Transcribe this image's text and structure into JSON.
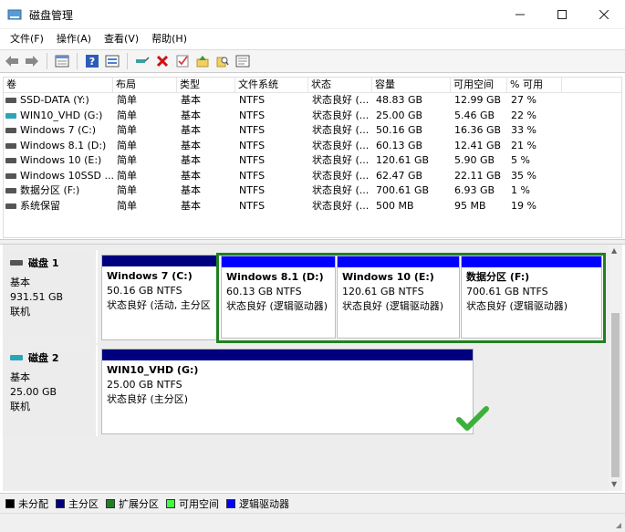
{
  "window": {
    "title": "磁盘管理",
    "controls": [
      "minimize-icon",
      "maximize-icon",
      "close-icon"
    ]
  },
  "menu": [
    "文件(F)",
    "操作(A)",
    "查看(V)",
    "帮助(H)"
  ],
  "toolbar": [
    "back-arrow-icon",
    "forward-arrow-icon",
    "properties-icon",
    "help-icon",
    "refresh-icon",
    "connect-icon",
    "delete-icon",
    "check-icon",
    "up-icon",
    "search-icon",
    "list-icon"
  ],
  "volumes": {
    "headers": [
      "卷",
      "布局",
      "类型",
      "文件系统",
      "状态",
      "容量",
      "可用空间",
      "% 可用"
    ],
    "rows": [
      {
        "icon": "drive-icon",
        "cells": [
          "SSD-DATA (Y:)",
          "简单",
          "基本",
          "NTFS",
          "状态良好 (...",
          "48.83 GB",
          "12.99 GB",
          "27 %"
        ]
      },
      {
        "icon": "vhd-drive-icon",
        "cells": [
          "WIN10_VHD (G:)",
          "简单",
          "基本",
          "NTFS",
          "状态良好 (...",
          "25.00 GB",
          "5.46 GB",
          "22 %"
        ]
      },
      {
        "icon": "drive-icon",
        "cells": [
          "Windows 7 (C:)",
          "简单",
          "基本",
          "NTFS",
          "状态良好 (...",
          "50.16 GB",
          "16.36 GB",
          "33 %"
        ]
      },
      {
        "icon": "drive-icon",
        "cells": [
          "Windows 8.1 (D:)",
          "简单",
          "基本",
          "NTFS",
          "状态良好 (...",
          "60.13 GB",
          "12.41 GB",
          "21 %"
        ]
      },
      {
        "icon": "drive-icon",
        "cells": [
          "Windows 10 (E:)",
          "简单",
          "基本",
          "NTFS",
          "状态良好 (...",
          "120.61 GB",
          "5.90 GB",
          "5 %"
        ]
      },
      {
        "icon": "drive-icon",
        "cells": [
          "Windows 10SSD ...",
          "简单",
          "基本",
          "NTFS",
          "状态良好 (...",
          "62.47 GB",
          "22.11 GB",
          "35 %"
        ]
      },
      {
        "icon": "drive-icon",
        "cells": [
          "数据分区 (F:)",
          "简单",
          "基本",
          "NTFS",
          "状态良好 (...",
          "700.61 GB",
          "6.93 GB",
          "1 %"
        ]
      },
      {
        "icon": "drive-icon",
        "cells": [
          "系统保留",
          "简单",
          "基本",
          "NTFS",
          "状态良好 (...",
          "500 MB",
          "95 MB",
          "19 %"
        ]
      }
    ]
  },
  "disks": [
    {
      "name": "磁盘 1",
      "type": "基本",
      "size": "931.51 GB",
      "status": "联机",
      "partitions": [
        {
          "name": "Windows 7  (C:)",
          "size": "50.16 GB NTFS",
          "status": "状态良好 (活动, 主分区",
          "kind": "primary"
        },
        {
          "name": "Windows 8.1  (D:)",
          "size": "60.13 GB NTFS",
          "status": "状态良好 (逻辑驱动器)",
          "kind": "logical"
        },
        {
          "name": "Windows 10  (E:)",
          "size": "120.61 GB NTFS",
          "status": "状态良好 (逻辑驱动器)",
          "kind": "logical"
        },
        {
          "name": "数据分区  (F:)",
          "size": "700.61 GB NTFS",
          "status": "状态良好 (逻辑驱动器)",
          "kind": "logical"
        }
      ]
    },
    {
      "name": "磁盘 2",
      "type": "基本",
      "size": "25.00 GB",
      "status": "联机",
      "partitions": [
        {
          "name": "WIN10_VHD  (G:)",
          "size": "25.00 GB NTFS",
          "status": "状态良好 (主分区)",
          "kind": "primary"
        }
      ]
    }
  ],
  "legend": [
    {
      "label": "未分配",
      "color": "#000000"
    },
    {
      "label": "主分区",
      "color": "#00007f"
    },
    {
      "label": "扩展分区",
      "color": "#208020"
    },
    {
      "label": "可用空间",
      "color": "#40ff40"
    },
    {
      "label": "逻辑驱动器",
      "color": "#0000ff"
    }
  ],
  "colors": {
    "primary": "#00007f",
    "logical": "#0000ff",
    "extended": "#208020",
    "check": "#3bb03b"
  }
}
